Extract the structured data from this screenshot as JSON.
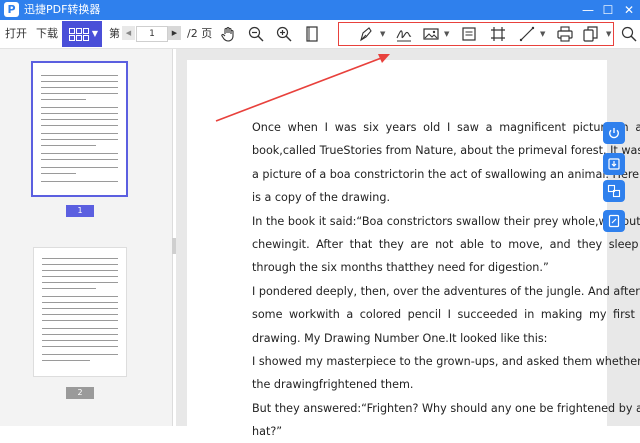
{
  "app": {
    "title": "迅捷PDF转换器",
    "logo": "P"
  },
  "window": {
    "minimize": "—",
    "maximize": "☐",
    "close": "✕"
  },
  "toolbar": {
    "open_label": "打开",
    "download_label": "下载",
    "page_prefix": "第",
    "page_value": "1",
    "page_total": "/2 页"
  },
  "sidebar": {
    "pages": [
      {
        "number": "1"
      },
      {
        "number": "2"
      }
    ]
  },
  "document": {
    "lines": [
      "Once when I was six years old I saw a magnificent picture in a",
      "book,called TrueStories from Nature, about the primeval forest. It was",
      "a picture of a boa constrictorin the act of swallowing an animal. Here",
      "is a copy of the drawing.",
      "In the book it said:“Boa constrictors swallow their prey whole,without",
      "chewingit. After that they are not able to move, and they sleep",
      "through the six months thatthey need for digestion.”",
      "I pondered deeply, then, over the adventures of the jungle. And after",
      "some workwith a colored pencil I succeeded in making my first",
      "drawing. My Drawing Number One.It looked like this:",
      "I showed my masterpiece to the grown-ups, and asked them whether",
      "the drawingfrightened them.",
      "But they answered:“Frighten? Why should any one be frightened by a",
      "hat?”"
    ]
  },
  "colors": {
    "brand": "#2f80ed",
    "accent": "#4a4fd8",
    "highlight": "#e8413c"
  },
  "icons": [
    "hand-icon",
    "zoom-out-icon",
    "zoom-in-icon",
    "fit-page-icon",
    "pen-icon",
    "signature-icon",
    "image-icon",
    "note-icon",
    "crop-icon",
    "line-icon",
    "print-icon",
    "copy-icon",
    "search-icon"
  ]
}
